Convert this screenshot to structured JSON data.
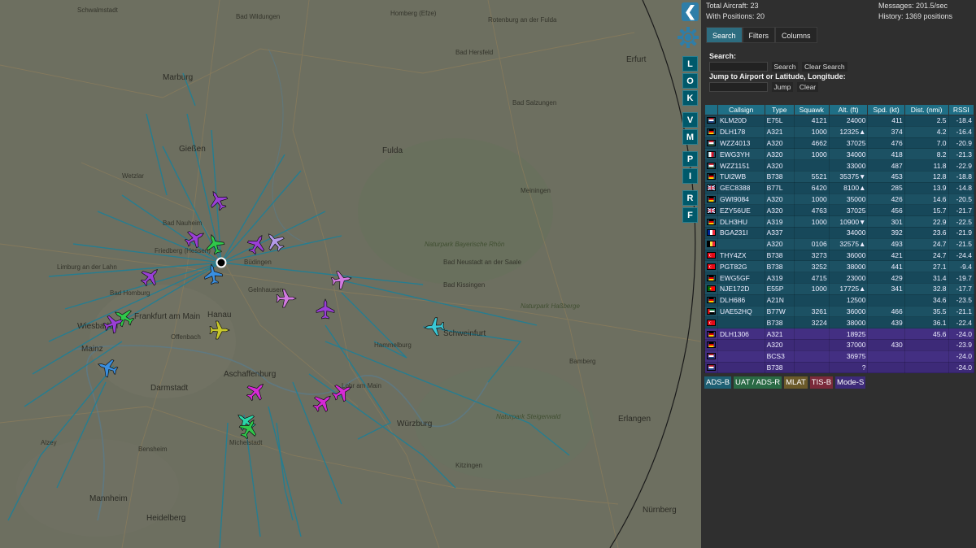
{
  "map": {
    "towns": [
      {
        "t": "Schwalmstadt",
        "big": false
      },
      {
        "t": "Bad Wildungen",
        "big": false
      },
      {
        "t": "Homberg (Efze)",
        "big": false
      },
      {
        "t": "Rotenburg an der Fulda",
        "big": false
      },
      {
        "t": "Bad Hersfeld",
        "big": false
      },
      {
        "t": "Marburg",
        "big": true
      },
      {
        "t": "Gießen",
        "big": true
      },
      {
        "t": "Wetzlar",
        "big": false
      },
      {
        "t": "Fulda",
        "big": true
      },
      {
        "t": "Bad Nauheim",
        "big": false
      },
      {
        "t": "Friedberg (Hessen)",
        "big": false
      },
      {
        "t": "Büdingen",
        "big": false
      },
      {
        "t": "Gelnhausen",
        "big": false
      },
      {
        "t": "Hanau",
        "big": true
      },
      {
        "t": "Frankfurt am Main",
        "big": true
      },
      {
        "t": "Offenbach",
        "big": false
      },
      {
        "t": "Wiesbaden",
        "big": true
      },
      {
        "t": "Mainz",
        "big": true
      },
      {
        "t": "Darmstadt",
        "big": true
      },
      {
        "t": "Aschaffenburg",
        "big": true
      },
      {
        "t": "Mannheim",
        "big": true
      },
      {
        "t": "Heidelberg",
        "big": true
      },
      {
        "t": "Würzburg",
        "big": true
      },
      {
        "t": "Schweinfurt",
        "big": true
      },
      {
        "t": "Bad Kissingen",
        "big": false
      },
      {
        "t": "Bad Neustadt an der Saale",
        "big": false
      },
      {
        "t": "Erfurt",
        "big": true
      },
      {
        "t": "Bad Salzungen",
        "big": false
      },
      {
        "t": "Meiningen",
        "big": false
      },
      {
        "t": "Erlangen",
        "big": true
      },
      {
        "t": "Nürnberg",
        "big": true
      },
      {
        "t": "Limburg an der Lahn",
        "big": false
      },
      {
        "t": "Bad Homburg",
        "big": false
      },
      {
        "t": "Kitzingen",
        "big": false
      },
      {
        "t": "Lohr am Main",
        "big": false
      },
      {
        "t": "Bamberg",
        "big": false
      },
      {
        "t": "Alzey",
        "big": false
      },
      {
        "t": "Bensheim",
        "big": false
      },
      {
        "t": "Hammelburg",
        "big": false
      },
      {
        "t": "Michelstadt",
        "big": false
      }
    ],
    "parks": [
      {
        "t": "Naturpark Bayerische Rhön"
      },
      {
        "t": "Naturpark Haßberge"
      },
      {
        "t": "Naturpark Steigerwald"
      }
    ]
  },
  "controls": {
    "toggle": "❮",
    "buttons": [
      "L",
      "O",
      "K",
      "V",
      "M",
      "P",
      "I",
      "R",
      "F"
    ]
  },
  "stats": {
    "total": "Total Aircraft: 23",
    "positions": "With Positions: 20",
    "messages": "Messages: 201.5/sec",
    "history": "History: 1369 positions"
  },
  "tabs": [
    "Search",
    "Filters",
    "Columns"
  ],
  "search": {
    "search_label": "Search:",
    "search_btn": "Search",
    "clear_search_btn": "Clear Search",
    "jump_label": "Jump to Airport or Latitude, Longitude:",
    "jump_btn": "Jump",
    "clear_btn": "Clear"
  },
  "table": {
    "headers": [
      "Callsign",
      "Type",
      "Squawk",
      "Alt. (ft)",
      "Spd. (kt)",
      "Dist. (nmi)",
      "RSSI"
    ],
    "rows": [
      {
        "flag": "nl",
        "callsign": "KLM20D",
        "type": "E75L",
        "squawk": "4121",
        "alt": "24000",
        "spd": "411",
        "dist": "2.5",
        "rssi": "-18.4",
        "kind": "adsb"
      },
      {
        "flag": "de",
        "callsign": "DLH178",
        "type": "A321",
        "squawk": "1000",
        "alt": "12325▲",
        "spd": "374",
        "dist": "4.2",
        "rssi": "-16.4",
        "kind": "adsb"
      },
      {
        "flag": "hu",
        "callsign": "WZZ4013",
        "type": "A320",
        "squawk": "4662",
        "alt": "37025",
        "spd": "476",
        "dist": "7.0",
        "rssi": "-20.9",
        "kind": "adsb"
      },
      {
        "flag": "mt",
        "callsign": "EWG3YH",
        "type": "A320",
        "squawk": "1000",
        "alt": "34000",
        "spd": "418",
        "dist": "8.2",
        "rssi": "-21.3",
        "kind": "adsb"
      },
      {
        "flag": "hu",
        "callsign": "WZZ1151",
        "type": "A320",
        "squawk": "",
        "alt": "33000",
        "spd": "487",
        "dist": "11.8",
        "rssi": "-22.9",
        "kind": "adsb"
      },
      {
        "flag": "de",
        "callsign": "TUI2WB",
        "type": "B738",
        "squawk": "5521",
        "alt": "35375▼",
        "spd": "453",
        "dist": "12.8",
        "rssi": "-18.8",
        "kind": "adsb"
      },
      {
        "flag": "gb",
        "callsign": "GEC8388",
        "type": "B77L",
        "squawk": "6420",
        "alt": "8100▲",
        "spd": "285",
        "dist": "13.9",
        "rssi": "-14.8",
        "kind": "adsb"
      },
      {
        "flag": "de",
        "callsign": "GWI9084",
        "type": "A320",
        "squawk": "1000",
        "alt": "35000",
        "spd": "426",
        "dist": "14.6",
        "rssi": "-20.5",
        "kind": "adsb"
      },
      {
        "flag": "gb",
        "callsign": "EZY56UE",
        "type": "A320",
        "squawk": "4763",
        "alt": "37025",
        "spd": "456",
        "dist": "15.7",
        "rssi": "-21.7",
        "kind": "adsb"
      },
      {
        "flag": "de",
        "callsign": "DLH3HU",
        "type": "A319",
        "squawk": "1000",
        "alt": "10900▼",
        "spd": "301",
        "dist": "22.9",
        "rssi": "-22.5",
        "kind": "adsb"
      },
      {
        "flag": "fr",
        "callsign": "BGA231I",
        "type": "A337",
        "squawk": "",
        "alt": "34000",
        "spd": "392",
        "dist": "23.6",
        "rssi": "-21.9",
        "kind": "adsb"
      },
      {
        "flag": "be",
        "callsign": "",
        "type": "A320",
        "squawk": "0106",
        "alt": "32575▲",
        "spd": "493",
        "dist": "24.7",
        "rssi": "-21.5",
        "kind": "adsb"
      },
      {
        "flag": "tr",
        "callsign": "THY4ZX",
        "type": "B738",
        "squawk": "3273",
        "alt": "36000",
        "spd": "421",
        "dist": "24.7",
        "rssi": "-24.4",
        "kind": "adsb"
      },
      {
        "flag": "tr",
        "callsign": "PGT82G",
        "type": "B738",
        "squawk": "3252",
        "alt": "38000",
        "spd": "441",
        "dist": "27.1",
        "rssi": "-9.4",
        "kind": "adsb"
      },
      {
        "flag": "de",
        "callsign": "EWG5GF",
        "type": "A319",
        "squawk": "4715",
        "alt": "23000",
        "spd": "429",
        "dist": "31.4",
        "rssi": "-19.7",
        "kind": "adsb"
      },
      {
        "flag": "pt",
        "callsign": "NJE172D",
        "type": "E55P",
        "squawk": "1000",
        "alt": "17725▲",
        "spd": "341",
        "dist": "32.8",
        "rssi": "-17.7",
        "kind": "adsb"
      },
      {
        "flag": "de",
        "callsign": "DLH686",
        "type": "A21N",
        "squawk": "",
        "alt": "12500",
        "spd": "",
        "dist": "34.6",
        "rssi": "-23.5",
        "kind": "adsb"
      },
      {
        "flag": "ae",
        "callsign": "UAE52HQ",
        "type": "B77W",
        "squawk": "3261",
        "alt": "36000",
        "spd": "466",
        "dist": "35.5",
        "rssi": "-21.1",
        "kind": "adsb"
      },
      {
        "flag": "tr",
        "callsign": "",
        "type": "B738",
        "squawk": "3224",
        "alt": "38000",
        "spd": "439",
        "dist": "36.1",
        "rssi": "-22.4",
        "kind": "adsb"
      },
      {
        "flag": "de",
        "callsign": "DLH1306",
        "type": "A321",
        "squawk": "",
        "alt": "18925",
        "spd": "",
        "dist": "45.6",
        "rssi": "-24.0",
        "kind": "modes"
      },
      {
        "flag": "de",
        "callsign": "",
        "type": "A320",
        "squawk": "",
        "alt": "37000",
        "spd": "430",
        "dist": "",
        "rssi": "-23.9",
        "kind": "modes"
      },
      {
        "flag": "nl",
        "callsign": "",
        "type": "BCS3",
        "squawk": "",
        "alt": "36975",
        "spd": "",
        "dist": "",
        "rssi": "-24.0",
        "kind": "modes"
      },
      {
        "flag": "nl",
        "callsign": "",
        "type": "B738",
        "squawk": "",
        "alt": "?",
        "spd": "",
        "dist": "",
        "rssi": "-24.0",
        "kind": "modes"
      }
    ]
  },
  "legend": [
    {
      "label": "ADS-B",
      "color": "#1e5f73"
    },
    {
      "label": "UAT / ADS-R",
      "color": "#2a6a45"
    },
    {
      "label": "MLAT",
      "color": "#6b5a2a"
    },
    {
      "label": "TIS-B",
      "color": "#7a2a3a"
    },
    {
      "label": "Mode-S",
      "color": "#3d2a78"
    }
  ],
  "aircraft_colors": {
    "violet": "#9a3fd6",
    "green": "#2fc84a",
    "blue": "#3a8fe0",
    "pink": "#d27ae0",
    "magenta": "#d62ad6",
    "yellow": "#c8c82a",
    "cyan": "#3ac8d6",
    "teal": "#2ad6a8",
    "lavender": "#b49ae8"
  }
}
